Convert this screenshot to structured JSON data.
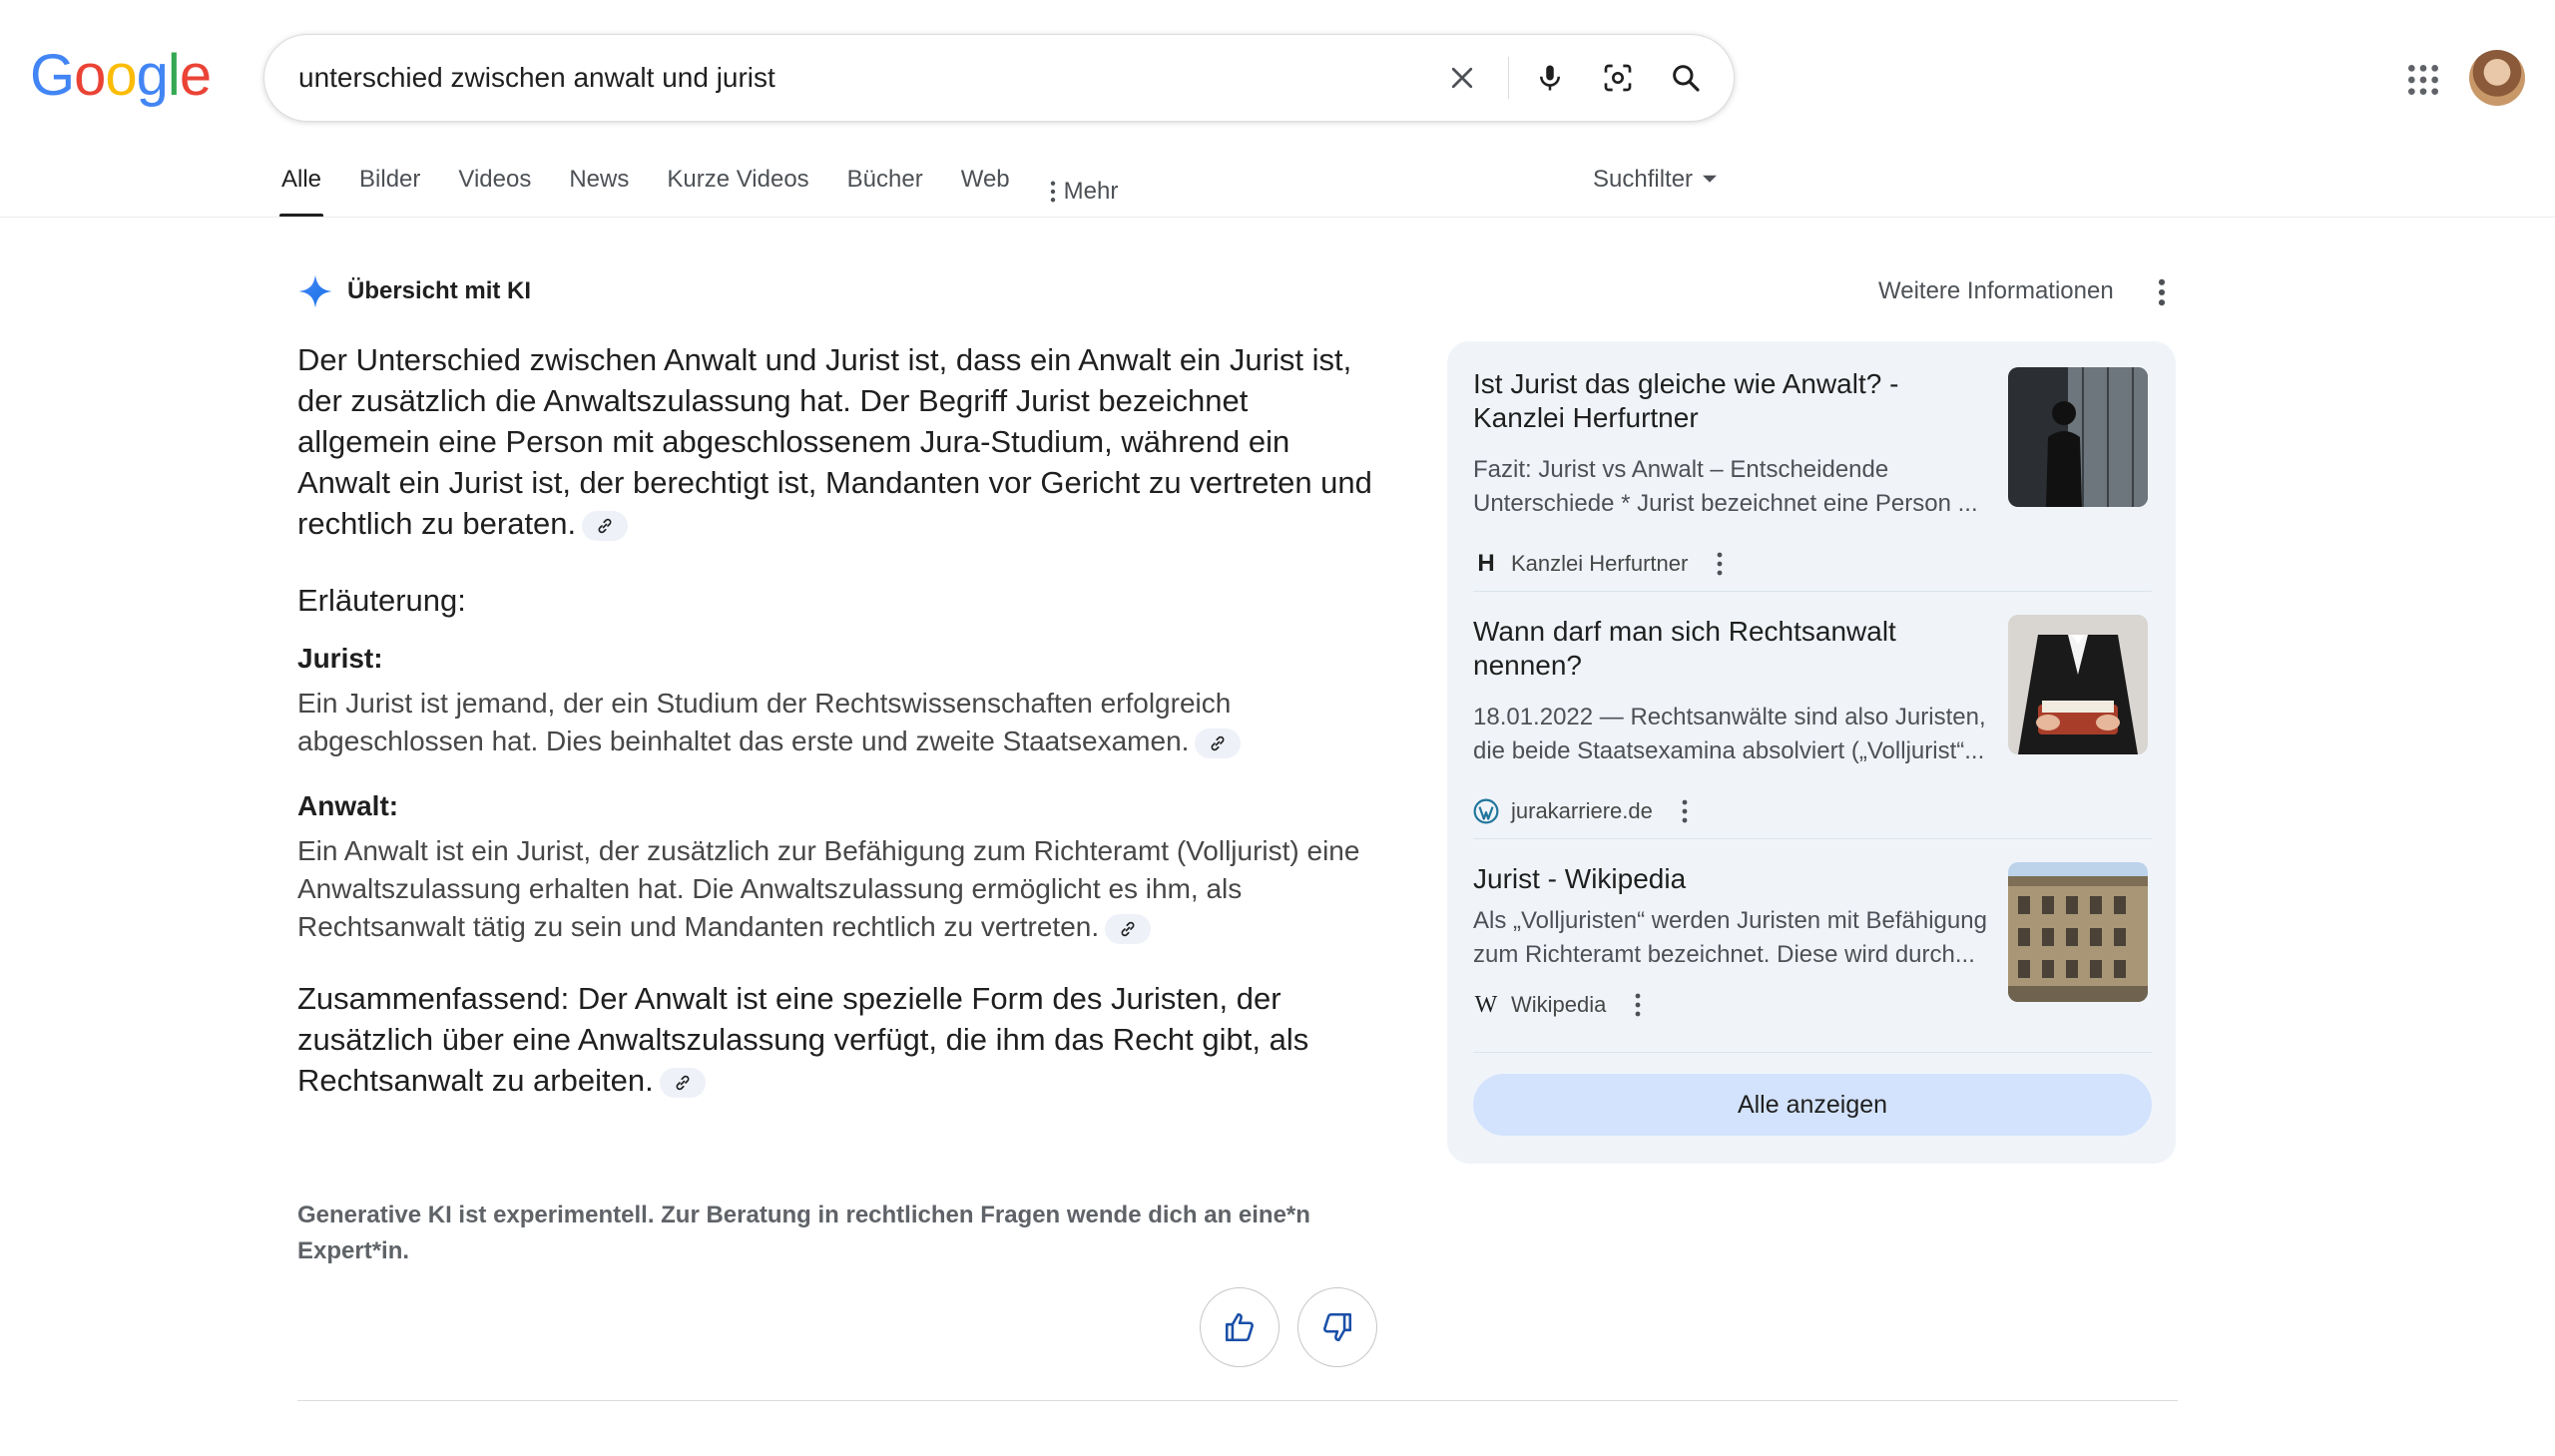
{
  "header": {
    "logo_text": "Google",
    "query": "unterschied zwischen anwalt und jurist"
  },
  "tabs": {
    "items": [
      "Alle",
      "Bilder",
      "Videos",
      "News",
      "Kurze Videos",
      "Bücher",
      "Web"
    ],
    "more": "Mehr",
    "filter": "Suchfilter"
  },
  "ai_overview": {
    "title": "Übersicht mit KI",
    "more_info": "Weitere Informationen",
    "intro": "Der Unterschied zwischen Anwalt und Jurist ist, dass ein Anwalt ein Jurist ist, der zusätzlich die Anwaltszulassung hat. Der Begriff Jurist bezeichnet allgemein eine Person mit abgeschlossenem Jura-Studium, während ein Anwalt ein Jurist ist, der berechtigt ist, Mandanten vor Gericht zu vertreten und rechtlich zu beraten.",
    "explanation_heading": "Erläuterung:",
    "jurist_heading": "Jurist:",
    "jurist_text": "Ein Jurist ist jemand, der ein Studium der Rechtswissenschaften erfolgreich abgeschlossen hat. Dies beinhaltet das erste und zweite Staatsexamen.",
    "anwalt_heading": "Anwalt:",
    "anwalt_text": "Ein Anwalt ist ein Jurist, der zusätzlich zur Befähigung zum Richteramt (Volljurist) eine Anwaltszulassung erhalten hat. Die Anwaltszulassung ermöglicht es ihm, als Rechtsanwalt tätig zu sein und Mandanten rechtlich zu vertreten.",
    "summary": "Zusammenfassend: Der Anwalt ist eine spezielle Form des Juristen, der zusätzlich über eine Anwaltszulassung verfügt, die ihm das Recht gibt, als Rechtsanwalt zu arbeiten.",
    "disclaimer": "Generative KI ist experimentell. Zur Beratung in rechtlichen Fragen wende dich an eine*n Expert*in."
  },
  "sources": {
    "items": [
      {
        "title": "Ist Jurist das gleiche wie Anwalt? - Kanzlei Herfurtner",
        "snippet": "Fazit: Jurist vs Anwalt – Entscheidende Unterschiede * Jurist bezeichnet eine Person ...",
        "site": "Kanzlei Herfurtner",
        "favicon": "H"
      },
      {
        "title": "Wann darf man sich Rechtsanwalt nennen?",
        "snippet": "18.01.2022 — Rechtsanwälte sind also Juristen, die beide Staatsexamina absolviert („Volljurist“...",
        "site": "jurakarriere.de",
        "favicon": "wordpress-icon"
      },
      {
        "title": "Jurist - Wikipedia",
        "snippet": "Als „Volljuristen“ werden Juristen mit Befähigung zum Richteramt bezeichnet. Diese wird durch...",
        "site": "Wikipedia",
        "favicon": "W"
      }
    ],
    "show_all": "Alle anzeigen"
  },
  "colors": {
    "google_blue": "#4285F4",
    "google_red": "#EA4335",
    "google_yellow": "#FBBC05",
    "google_green": "#34A853",
    "panel_bg": "#f0f4f9",
    "button_bg": "#d3e3fd"
  }
}
